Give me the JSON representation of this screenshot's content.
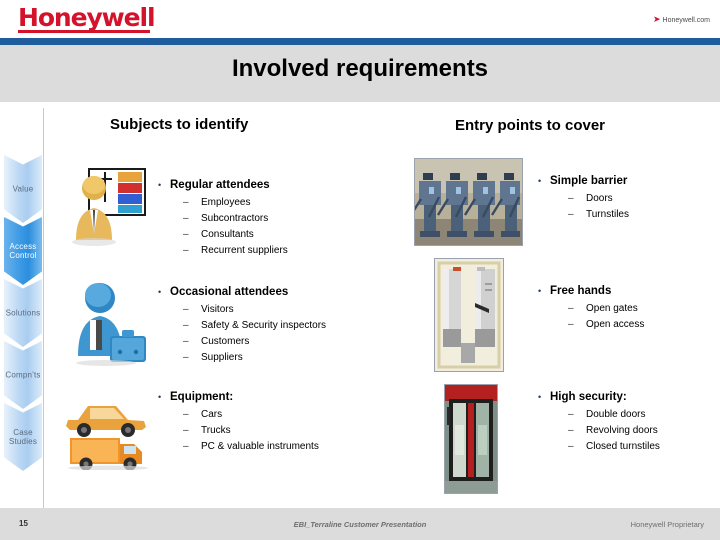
{
  "header": {
    "logo_text": "Honeywell",
    "link_text": "Honeywell.com",
    "link_arrow": "arrow-right-icon",
    "accent_red": "#d4122b",
    "accent_blue": "#1f5c9e"
  },
  "title": "Involved requirements",
  "sidebar": {
    "items": [
      {
        "label": "Value",
        "active": false
      },
      {
        "label": "Access\nControl",
        "label_line1": "Access",
        "label_line2": "Control",
        "active": true
      },
      {
        "label": "Solutions",
        "active": false
      },
      {
        "label": "Compn'ts",
        "active": false
      },
      {
        "label": "Case\nStudies",
        "label_line1": "Case",
        "label_line2": "Studies",
        "active": false
      }
    ],
    "active_color": "#3c9ae4"
  },
  "columns": {
    "left": {
      "heading": "Subjects to identify",
      "groups": [
        {
          "title": "Regular attendees",
          "icon": "presenter-icon",
          "items": [
            "Employees",
            "Subcontractors",
            "Consultants",
            "Recurrent suppliers"
          ]
        },
        {
          "title": "Occasional attendees",
          "icon": "visitor-briefcase-icon",
          "items": [
            "Visitors",
            "Safety & Security inspectors",
            "Customers",
            "Suppliers"
          ]
        },
        {
          "title": "Equipment:",
          "icon": "car-truck-icon",
          "items": [
            "Cars",
            "Trucks",
            "PC & valuable instruments"
          ]
        }
      ]
    },
    "right": {
      "heading": "Entry points to cover",
      "groups": [
        {
          "title": "Simple barrier",
          "photo": "tripod-turnstiles-photo",
          "items": [
            "Doors",
            "Turnstiles"
          ]
        },
        {
          "title": "Free hands",
          "photo": "optical-speed-gates-photo",
          "items": [
            "Open gates",
            "Open access"
          ]
        },
        {
          "title": "High security:",
          "photo": "revolving-security-door-photo",
          "items": [
            "Double doors",
            "Revolving doors",
            "Closed turnstiles"
          ]
        }
      ]
    }
  },
  "bullets": {
    "dot": "•",
    "dash": "–"
  },
  "footer": {
    "page_number": "15",
    "center_text": "EBI_Terraline Customer Presentation",
    "right_text": "Honeywell Proprietary"
  }
}
